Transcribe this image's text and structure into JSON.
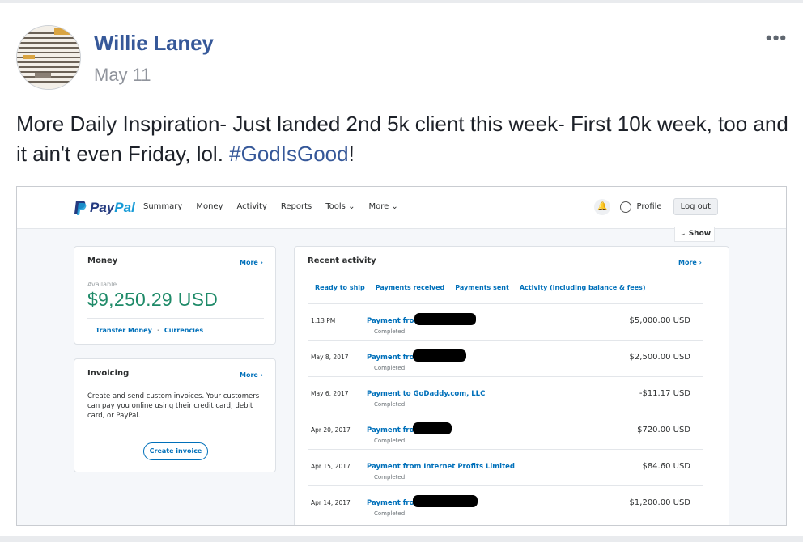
{
  "post": {
    "author": "Willie Laney",
    "date": "May 11",
    "more_menu": "•••",
    "text_before": "More Daily Inspiration- Just landed 2nd 5k client this week- First 10k week, too and it ain't even Friday, lol. ",
    "hashtag": "#GodIsGood",
    "text_after": "!",
    "link_color": "#365899"
  },
  "screenshot": {
    "brand": {
      "word1": "Pay",
      "word2": "Pal",
      "colors": [
        "#253b80",
        "#179bd7"
      ]
    },
    "nav": [
      "Summary",
      "Money",
      "Activity",
      "Reports",
      "Tools ⌄",
      "More ⌄"
    ],
    "profile_label": "Profile",
    "logout_label": "Log out",
    "show_label": "Show",
    "money_card": {
      "title": "Money",
      "more": "More ›",
      "available_label": "Available",
      "balance": "$9,250.29 USD",
      "balance_color": "#1e8a68",
      "link_transfer": "Transfer Money",
      "link_separator": "·",
      "link_currencies": "Currencies"
    },
    "invoicing_card": {
      "title": "Invoicing",
      "more": "More ›",
      "description": "Create and send custom invoices. Your customers can pay you online using their credit card, debit card, or PayPal.",
      "button": "Create invoice"
    },
    "recent_activity": {
      "title": "Recent activity",
      "more": "More ›",
      "filters": [
        "Ready to ship",
        "Payments received",
        "Payments sent",
        "Activity (including balance & fees)"
      ],
      "rows": [
        {
          "date": "1:13 PM",
          "name": "Payment from",
          "status": "Completed",
          "amount": "$5,000.00 USD"
        },
        {
          "date": "May 8, 2017",
          "name": "Payment from",
          "status": "Completed",
          "amount": "$2,500.00 USD"
        },
        {
          "date": "May 6, 2017",
          "name": "Payment to GoDaddy.com, LLC",
          "status": "Completed",
          "amount": "-$11.17 USD"
        },
        {
          "date": "Apr 20, 2017",
          "name": "Payment from",
          "status": "Completed",
          "amount": "$720.00 USD"
        },
        {
          "date": "Apr 15, 2017",
          "name": "Payment from Internet Profits Limited",
          "status": "Completed",
          "amount": "$84.60 USD"
        },
        {
          "date": "Apr 14, 2017",
          "name": "Payment from",
          "status": "Completed",
          "amount": "$1,200.00 USD"
        }
      ]
    }
  }
}
